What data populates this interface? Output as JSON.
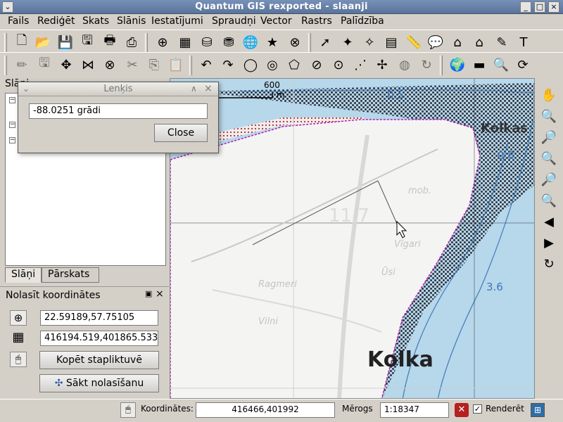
{
  "window": {
    "title": "Quantum GIS rexported - slaanji",
    "menu_button": "⌄",
    "min_button": "_",
    "max_button": "□",
    "close_button": "×"
  },
  "menubar": {
    "items": [
      "Fails",
      "Rediģēt",
      "Skats",
      "Slānis",
      "Iestatījumi",
      "Spraudņi",
      "Vector",
      "Rastrs",
      "Palīdzība"
    ]
  },
  "toolbar1": {
    "icons": [
      "new-project-icon",
      "open-project-icon",
      "save-project-icon",
      "save-as-icon",
      "print-composer-icon",
      "print-icon",
      "add-vector-layer-icon",
      "add-raster-layer-icon",
      "add-postgis-layer-icon",
      "add-wms-layer-icon",
      "add-new-layer-icon",
      "add-feature-icon",
      "remove-layer-icon",
      "identify-icon",
      "select-icon",
      "deselect-icon",
      "attribute-table-icon",
      "measure-line-icon",
      "map-tips-icon",
      "home-icon",
      "home-next-icon",
      "spell-icon",
      "text-annotation-icon"
    ]
  },
  "toolbar2": {
    "icons": [
      "pencil-icon",
      "save-edits-icon",
      "move-feature-icon",
      "node-tool-icon",
      "delete-selected-icon",
      "cut-icon",
      "copy-icon",
      "paste-icon",
      "undo-icon",
      "redo-icon",
      "add-ring-icon",
      "add-island-icon",
      "simplify-icon",
      "delete-ring-icon",
      "delete-part-icon",
      "reshape-icon",
      "split-icon",
      "merge-icon",
      "merge-attributes-icon",
      "rotate-icon",
      "globe-icon",
      "scale-bar-icon",
      "measure-icon",
      "refresh-icon"
    ]
  },
  "layers_panel": {
    "title": "Slāņi",
    "tabs": [
      "Slāņi",
      "Pārskats"
    ]
  },
  "coords_panel": {
    "title": "Nolasīt koordinātes",
    "geo_coords": "22.59189,57.75105",
    "proj_coords": "416194.519,401865.533",
    "copy_button": "Kopēt stapliktuvē",
    "start_button": "Sākt nolasīšanu",
    "float_button": "▣",
    "close_button": "×"
  },
  "dialog": {
    "title": "Lenķis",
    "value": "-88.0251 grādi",
    "close_label": "Close",
    "menu_button": "⌄",
    "up_button": "∧",
    "close_x": "×"
  },
  "map": {
    "scale_value": "600",
    "scale_unit": "m",
    "labels": {
      "kolka_town": "Kolka",
      "kolkasrags": "Kolkas",
      "depth_0_5": "0.5",
      "depth_0_8": "0.8",
      "depth_3_6": "3.6",
      "elev_11_7": "11.7",
      "mob": "mob.",
      "vigari": "Vīgari",
      "usi": "Ūsi",
      "ragmeri": "Ragmeri",
      "vilni": "Vilni"
    }
  },
  "statusbar": {
    "coords_label": "Koordinātes:",
    "coords_value": "416466,401992",
    "scale_label": "Mērogs",
    "scale_value": "1:18347",
    "render_label": "Renderēt",
    "render_checked": true
  },
  "colors": {
    "sea": "#b7d7ea",
    "land": "#f4f4f2",
    "hatch": "#3b3b3b",
    "polygon_edge": "#b21bb3",
    "depth_text": "#3d79b8",
    "title_gradient": "#5a7499"
  }
}
